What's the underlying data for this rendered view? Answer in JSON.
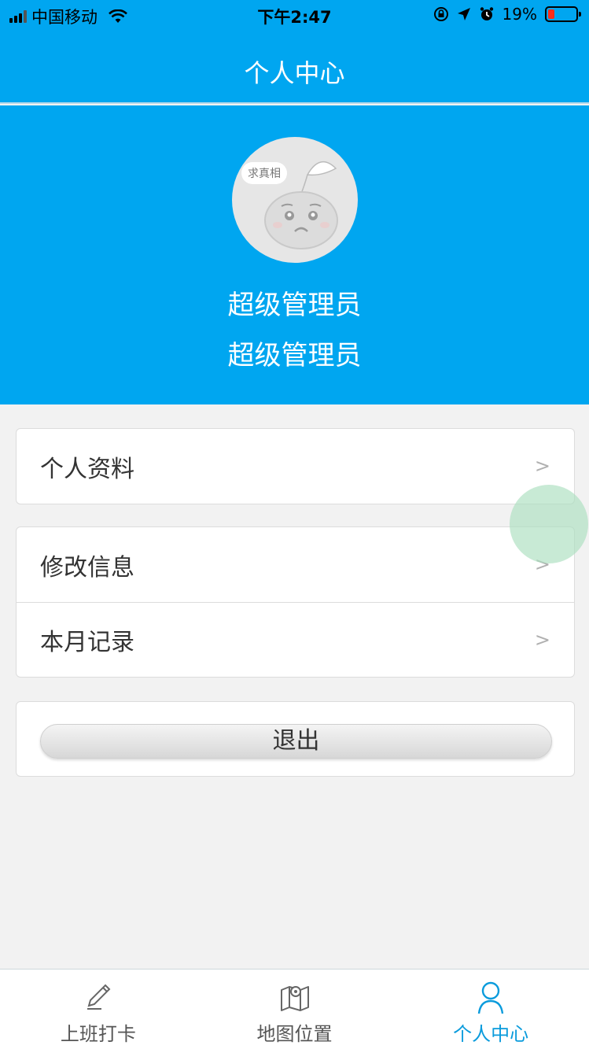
{
  "status_bar": {
    "carrier": "中国移动",
    "time": "下午2:47",
    "battery": "19%",
    "battery_level": 0.19,
    "icons": [
      "signal-icon",
      "wifi-icon",
      "orientation-lock-icon",
      "location-icon",
      "alarm-icon",
      "battery-icon"
    ]
  },
  "header": {
    "title": "个人中心"
  },
  "profile": {
    "avatar_tag": "求真相",
    "name": "超级管理员",
    "role": "超级管理员"
  },
  "menu": {
    "group1": [
      {
        "label": "个人资料",
        "chevron": ">"
      }
    ],
    "group2": [
      {
        "label": "修改信息",
        "chevron": ">"
      },
      {
        "label": "本月记录",
        "chevron": ">"
      }
    ],
    "logout_label": "退出"
  },
  "tab_bar": {
    "tabs": [
      {
        "label": "上班打卡",
        "icon": "pencil-icon",
        "active": false
      },
      {
        "label": "地图位置",
        "icon": "map-icon",
        "active": false
      },
      {
        "label": "个人中心",
        "icon": "user-icon",
        "active": true
      }
    ]
  },
  "colors": {
    "brand": "#00a6f0",
    "active_tab": "#0a9bdc",
    "background": "#f2f2f2"
  }
}
